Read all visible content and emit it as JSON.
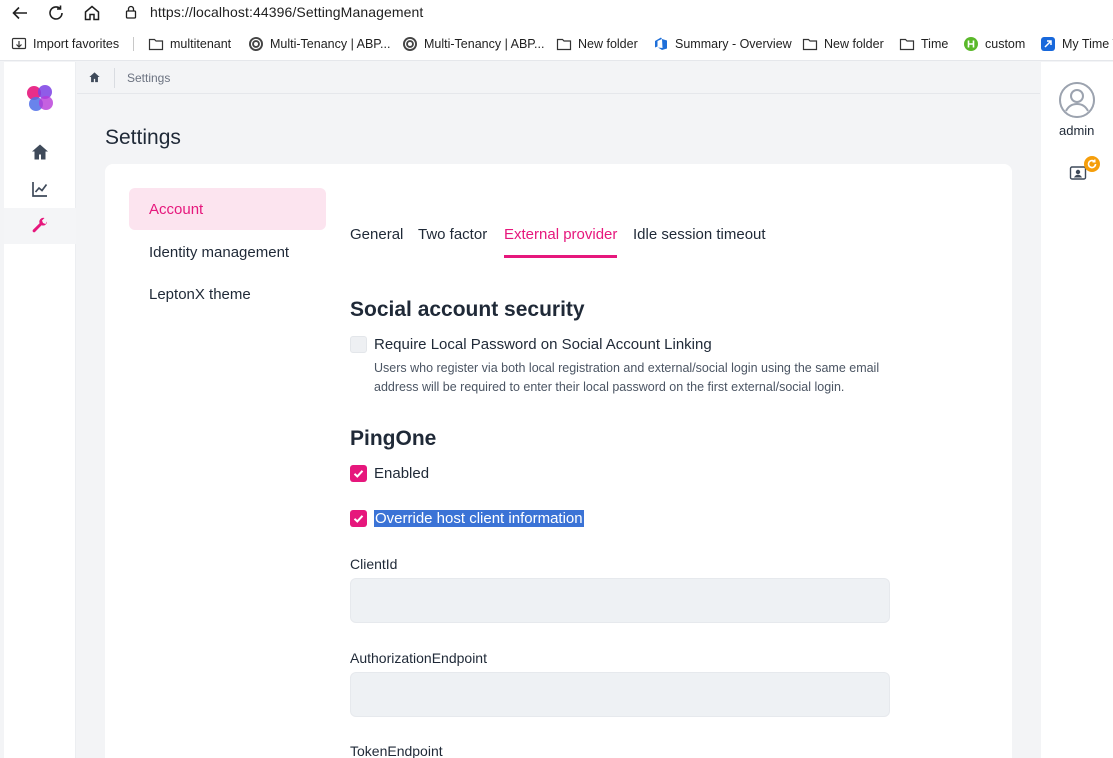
{
  "browser": {
    "url_prefix": "https://",
    "url_host": "localhost",
    "url_rest": ":44396/SettingManagement",
    "favorites": [
      {
        "label": "Import favorites",
        "icon": "import-icon"
      },
      {
        "label": "multitenant",
        "icon": "folder-icon"
      },
      {
        "label": "Multi-Tenancy | ABP...",
        "icon": "abp-icon"
      },
      {
        "label": "Multi-Tenancy | ABP...",
        "icon": "abp-icon"
      },
      {
        "label": "New folder",
        "icon": "folder-icon"
      },
      {
        "label": "Summary - Overview",
        "icon": "azure-devops-icon"
      },
      {
        "label": "New folder",
        "icon": "folder-icon"
      },
      {
        "label": "Time",
        "icon": "folder-icon"
      },
      {
        "label": "custom",
        "icon": "custom-icon"
      },
      {
        "label": "My Time T",
        "icon": "jira-icon"
      }
    ]
  },
  "breadcrumb": {
    "current": "Settings"
  },
  "page": {
    "title": "Settings"
  },
  "settings_nav": [
    {
      "label": "Account",
      "active": true
    },
    {
      "label": "Identity management",
      "active": false
    },
    {
      "label": "LeptonX theme",
      "active": false
    }
  ],
  "tabs": [
    {
      "label": "General",
      "active": false
    },
    {
      "label": "Two factor",
      "active": false
    },
    {
      "label": "External provider",
      "active": true
    },
    {
      "label": "Idle session timeout",
      "active": false
    }
  ],
  "social": {
    "title": "Social account security",
    "require_label": "Require Local Password on Social Account Linking",
    "require_checked": false,
    "help": "Users who register via both local registration and external/social login using the same email address will be required to enter their local password on the first external/social login."
  },
  "pingone": {
    "title": "PingOne",
    "enabled_label": "Enabled",
    "enabled_checked": true,
    "override_label": "Override host client information",
    "override_checked": true,
    "client_id_label": "ClientId",
    "client_id_value": "",
    "auth_endpoint_label": "AuthorizationEndpoint",
    "auth_endpoint_value": "",
    "token_endpoint_label": "TokenEndpoint"
  },
  "user": {
    "name": "admin"
  },
  "colors": {
    "accent": "#e6177c",
    "accent_light": "#fce4ef",
    "selection": "#3b73d6"
  }
}
